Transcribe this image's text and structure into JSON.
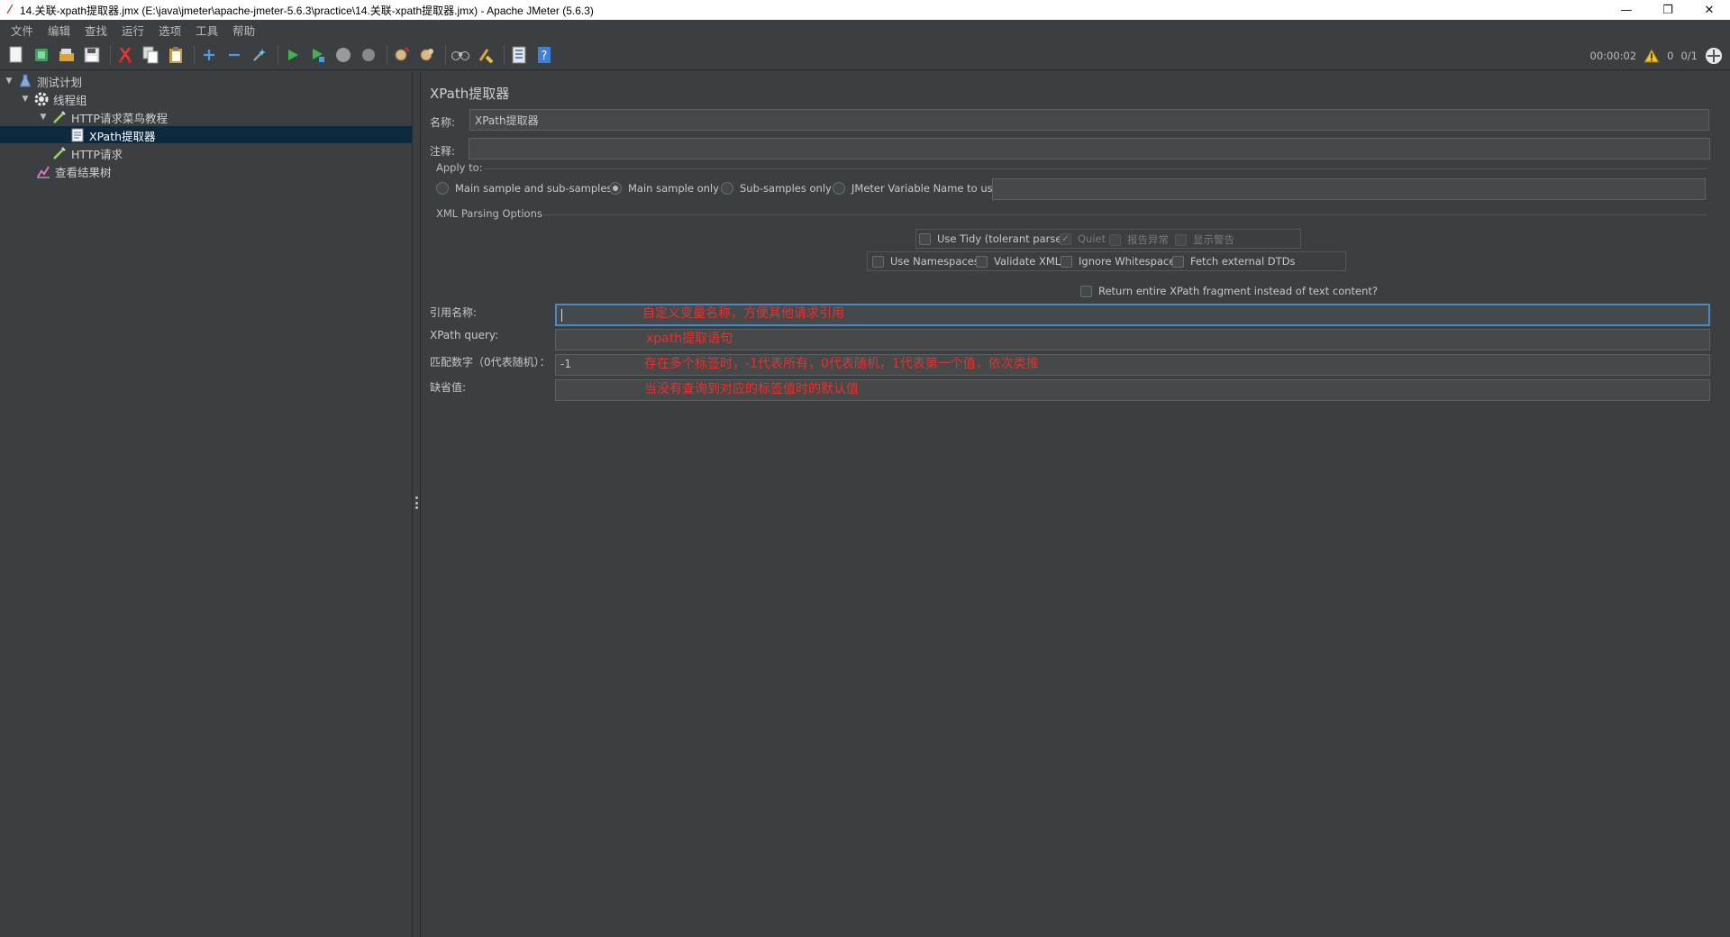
{
  "window": {
    "title": "14.关联-xpath提取器.jmx (E:\\java\\jmeter\\apache-jmeter-5.6.3\\practice\\14.关联-xpath提取器.jmx) - Apache JMeter (5.6.3)",
    "minimize": "—",
    "restore": "❐",
    "close": "✕"
  },
  "menu": [
    "文件",
    "编辑",
    "查找",
    "运行",
    "选项",
    "工具",
    "帮助"
  ],
  "status": {
    "timer": "00:00:02",
    "warnings": "0",
    "threads": "0/1"
  },
  "tree": {
    "items": [
      {
        "label": "测试计划",
        "icon": "flask-icon"
      },
      {
        "label": "线程组",
        "icon": "gear-icon"
      },
      {
        "label": "HTTP请求菜鸟教程",
        "icon": "pipette-icon"
      },
      {
        "label": "XPath提取器",
        "icon": "document-icon"
      },
      {
        "label": "HTTP请求",
        "icon": "pipette-icon"
      },
      {
        "label": "查看结果树",
        "icon": "chart-icon"
      }
    ]
  },
  "panel": {
    "title": "XPath提取器",
    "name_label": "名称:",
    "name_value": "XPath提取器",
    "comment_label": "注释:",
    "comment_value": "",
    "apply_to": {
      "title": "Apply to:",
      "options": [
        "Main sample and sub-samples",
        "Main sample only",
        "Sub-samples only",
        "JMeter Variable Name to use"
      ],
      "selected": "Main sample only",
      "variable_value": ""
    },
    "xml_parsing": {
      "title": "XML Parsing Options",
      "use_tidy": "Use Tidy (tolerant parser)",
      "quiet": "Quiet",
      "report_errors": "报告异常",
      "show_warnings": "显示警告",
      "use_namespaces": "Use Namespaces",
      "validate_xml": "Validate XML",
      "ignore_whitespace": "Ignore Whitespace",
      "fetch_dtds": "Fetch external DTDs",
      "return_fragment": "Return entire XPath fragment instead of text content?"
    },
    "ref_name_label": "引用名称:",
    "ref_name_value": "",
    "xpath_label": "XPath query:",
    "xpath_value": "",
    "match_label": "匹配数字（0代表随机）：",
    "match_value": "-1",
    "default_label": "缺省值:",
    "default_value": ""
  },
  "annotations": {
    "ref_name": "自定义变量名称，方便其他请求引用",
    "xpath": "xpath提取语句",
    "match": "存在多个标签时，-1代表所有，0代表随机，1代表第一个值，依次类推",
    "default": "当没有查询到对应的标签值时的默认值"
  },
  "colors": {
    "background": "#3c3f41",
    "selection": "#0d293e",
    "annotation": "#e5312f",
    "focus_border": "#4a88c7"
  }
}
